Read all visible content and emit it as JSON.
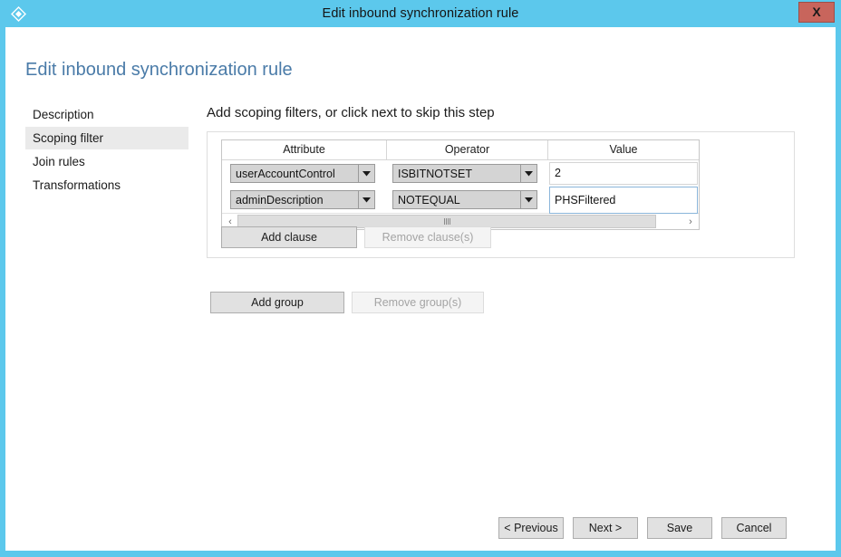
{
  "window": {
    "title": "Edit inbound synchronization rule",
    "icon": "diamond-app-icon",
    "close_label": "X",
    "border_color": "#5cc8ec",
    "titlebar_color": "#5cc8ec",
    "close_color": "#c8655c"
  },
  "page": {
    "heading": "Edit inbound synchronization rule",
    "heading_color": "#4a7ba8"
  },
  "sidebar": {
    "items": [
      {
        "label": "Description",
        "selected": false
      },
      {
        "label": "Scoping filter",
        "selected": true
      },
      {
        "label": "Join rules",
        "selected": false
      },
      {
        "label": "Transformations",
        "selected": false
      }
    ]
  },
  "main": {
    "instruction": "Add scoping filters, or click next to skip this step",
    "grid": {
      "columns": [
        "Attribute",
        "Operator",
        "Value"
      ],
      "rows": [
        {
          "attribute": "userAccountControl",
          "operator": "ISBITNOTSET",
          "value": "2",
          "value_focused": false
        },
        {
          "attribute": "adminDescription",
          "operator": "NOTEQUAL",
          "value": "PHSFiltered",
          "value_focused": true
        }
      ],
      "scrollbar": {
        "left_arrow": "‹",
        "right_arrow": "›"
      }
    },
    "clause_buttons": {
      "add": {
        "label": "Add clause",
        "enabled": true
      },
      "remove": {
        "label": "Remove clause(s)",
        "enabled": false
      }
    },
    "group_buttons": {
      "add": {
        "label": "Add group",
        "enabled": true
      },
      "remove": {
        "label": "Remove group(s)",
        "enabled": false
      }
    }
  },
  "footer": {
    "previous": "< Previous",
    "next": "Next >",
    "save": "Save",
    "cancel": "Cancel"
  }
}
